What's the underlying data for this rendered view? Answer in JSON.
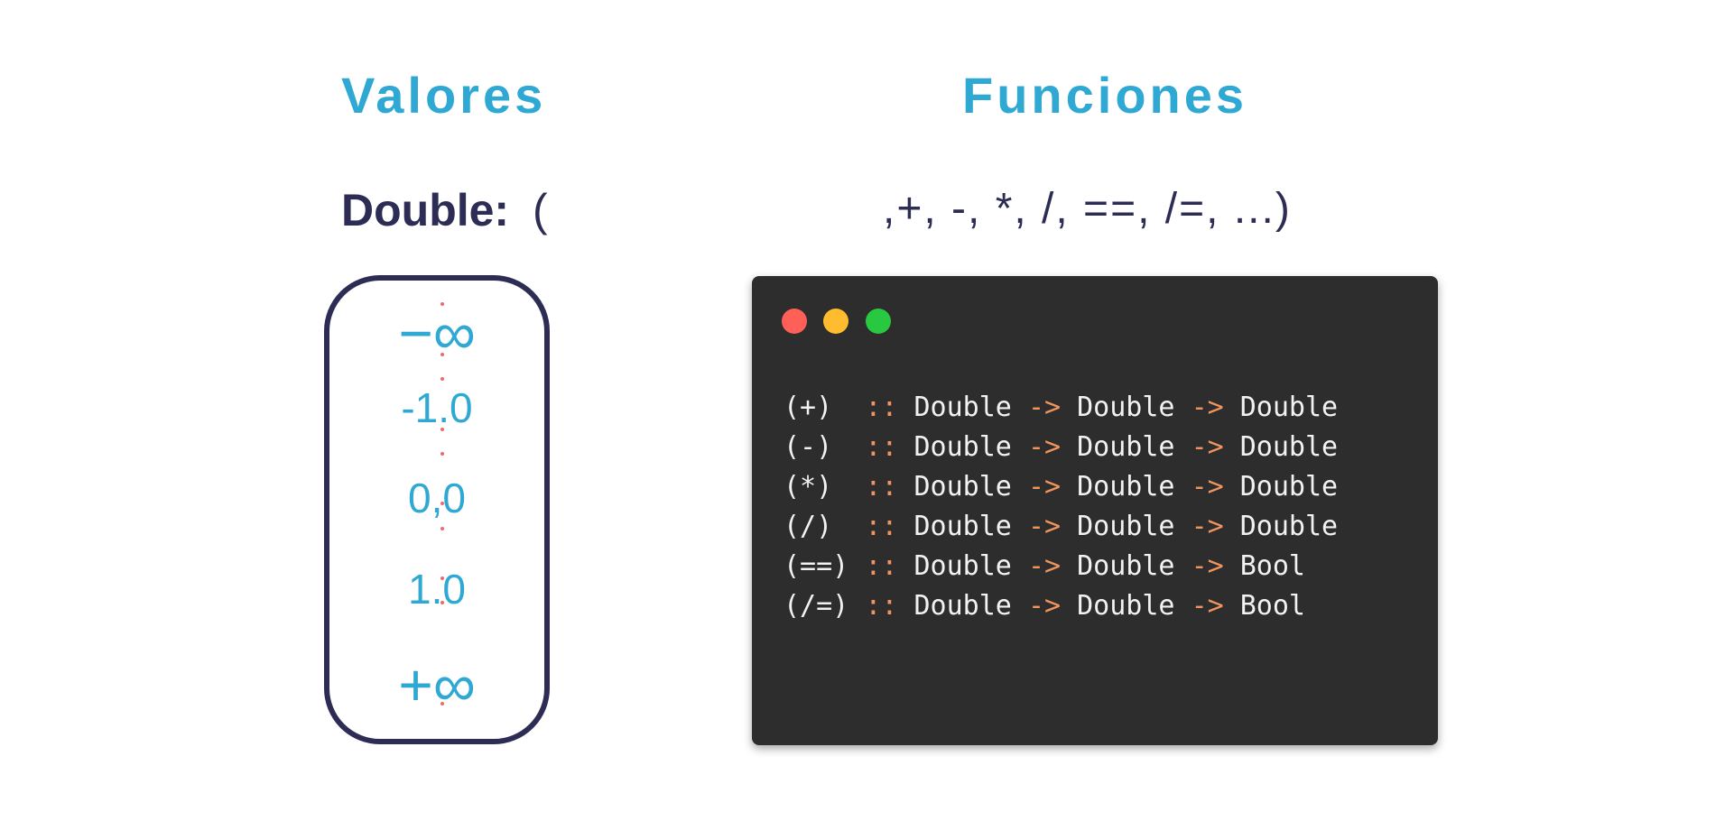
{
  "headings": {
    "values": "Valores",
    "functions": "Funciones"
  },
  "type_line": {
    "name": "Double:",
    "open_paren": "(",
    "operators": ",+, -, *, /, ==, /=, ...)"
  },
  "values": [
    "−∞",
    "-1.0",
    "0,0",
    "1.0",
    "+∞"
  ],
  "terminal": {
    "lines": [
      {
        "op": "(+) ",
        "sep1": "::",
        "t1": "Double",
        "arrow1": "->",
        "t2": "Double",
        "arrow2": "->",
        "t3": "Double"
      },
      {
        "op": "(-) ",
        "sep1": "::",
        "t1": "Double",
        "arrow1": "->",
        "t2": "Double",
        "arrow2": "->",
        "t3": "Double"
      },
      {
        "op": "(*) ",
        "sep1": "::",
        "t1": "Double",
        "arrow1": "->",
        "t2": "Double",
        "arrow2": "->",
        "t3": "Double"
      },
      {
        "op": "(/) ",
        "sep1": "::",
        "t1": "Double",
        "arrow1": "->",
        "t2": "Double",
        "arrow2": "->",
        "t3": "Double"
      },
      {
        "op": "(==)",
        "sep1": "::",
        "t1": "Double",
        "arrow1": "->",
        "t2": "Double",
        "arrow2": "->",
        "t3": "Bool"
      },
      {
        "op": "(/=)",
        "sep1": "::",
        "t1": "Double",
        "arrow1": "->",
        "t2": "Double",
        "arrow2": "->",
        "t3": "Bool"
      }
    ]
  },
  "colors": {
    "accent": "#2fa9d3",
    "dark": "#2c2c54",
    "terminal_bg": "#2d2d2d",
    "syntax": "#f0955e",
    "dots": "#f06a6a"
  }
}
